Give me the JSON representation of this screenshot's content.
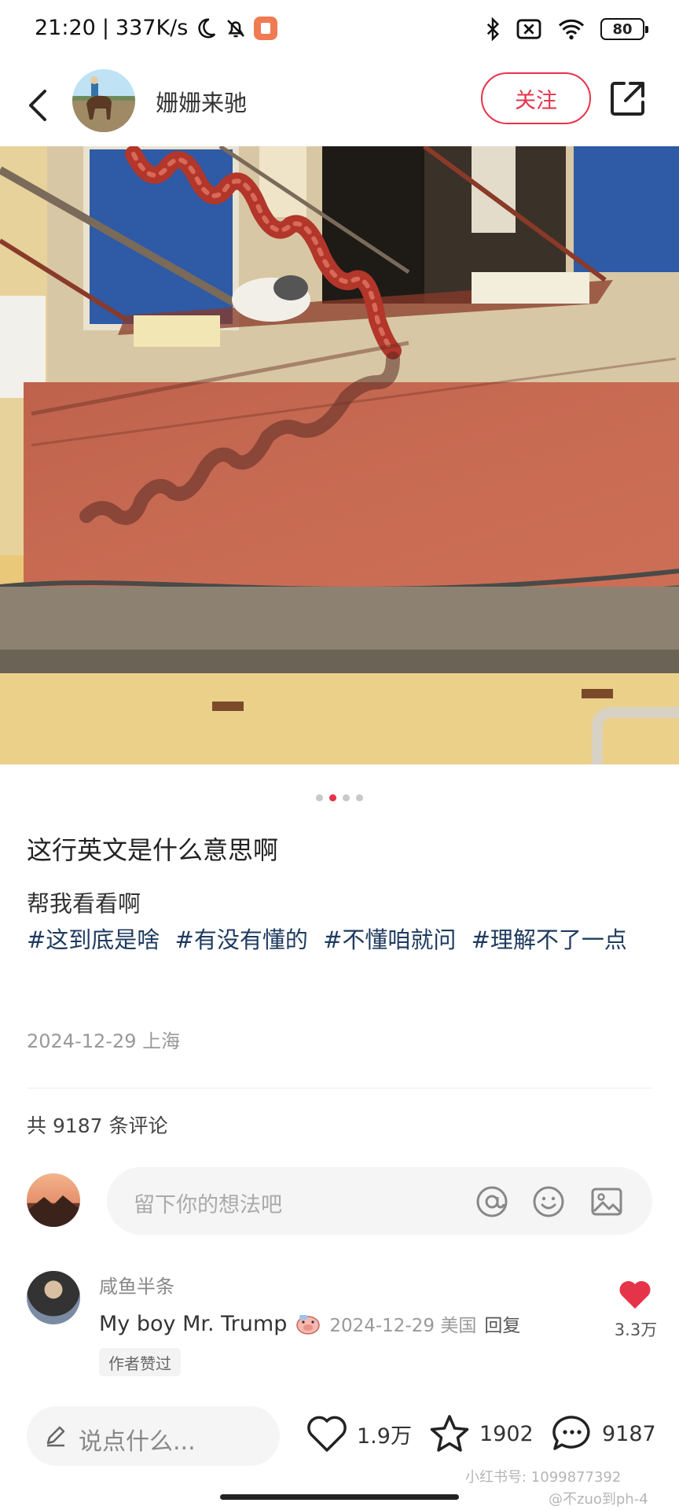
{
  "status_bar": {
    "time": "21:20",
    "speed": "337K/s",
    "battery": "80"
  },
  "header": {
    "author": "姗姗来驰",
    "follow_label": "关注"
  },
  "gallery": {
    "page_count": 4,
    "active_index": 1
  },
  "post": {
    "title": "这行英文是什么意思啊",
    "body": "帮我看看啊",
    "tags": [
      "#这到底是啥",
      "#有没有懂的",
      "#不懂咱就问",
      "#理解不了一点"
    ],
    "date_location": "2024-12-29 上海"
  },
  "comments": {
    "count_label": "共 9187 条评论",
    "input_placeholder": "留下你的想法吧",
    "items": [
      {
        "user": "咸鱼半条",
        "text": "My boy Mr. Trump",
        "date_location": "2024-12-29 美国",
        "reply_label": "回复",
        "badge": "作者赞过",
        "likes": "3.3万"
      }
    ]
  },
  "bottom_bar": {
    "say_placeholder": "说点什么...",
    "likes": "1.9万",
    "favorites": "1902",
    "comments": "9187"
  },
  "watermarks": {
    "xhs_id": "小红书号: 1099877392",
    "weibo": "@不zuo到ph-4"
  },
  "colors": {
    "accent": "#e5334a",
    "tag_text": "#1e3a5f",
    "wall": "#c96a52"
  }
}
